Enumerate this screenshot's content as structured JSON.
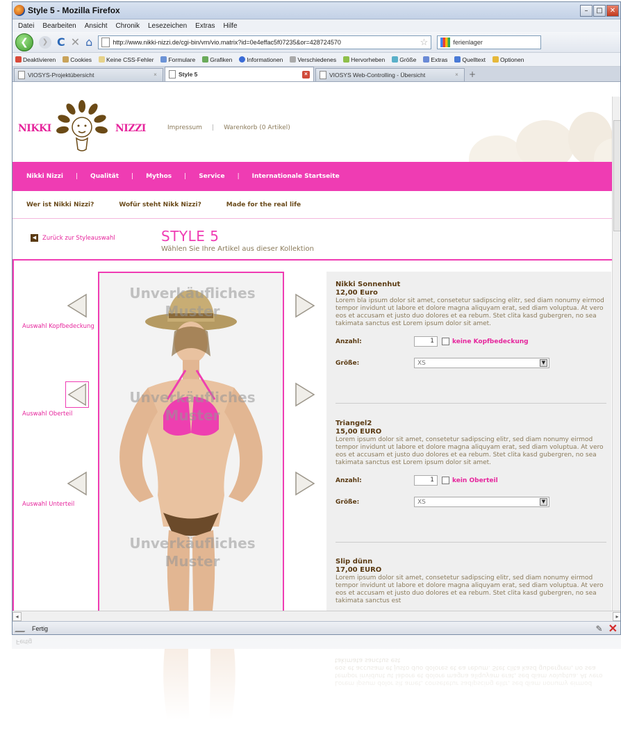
{
  "browser": {
    "window_title": "Style 5 - Mozilla Firefox",
    "menu": [
      "Datei",
      "Bearbeiten",
      "Ansicht",
      "Chronik",
      "Lesezeichen",
      "Extras",
      "Hilfe"
    ],
    "url": "http://www.nikki-nizzi.de/cgi-bin/vm/vio.matrix?id=0e4effac5f07235&or=428724570",
    "search_value": "ferienlager",
    "devbar": [
      "Deaktivieren",
      "Cookies",
      "Keine CSS-Fehler",
      "Formulare",
      "Grafiken",
      "Informationen",
      "Verschiedenes",
      "Hervorheben",
      "Größe",
      "Extras",
      "Quelltext",
      "Optionen"
    ],
    "tabs": [
      {
        "label": "VIOSYS-Projektübersicht",
        "active": false
      },
      {
        "label": "Style 5",
        "active": true
      },
      {
        "label": "VIOSYS Web-Controlling - Übersicht",
        "active": false
      }
    ],
    "new_tab": "+",
    "status_text": "Fertig"
  },
  "site": {
    "logo_left": "NIKKI",
    "logo_right": "NIZZI",
    "header_links": [
      "Impressum",
      "Warenkorb (0 Artikel)"
    ],
    "main_nav": [
      "Nikki Nizzi",
      "Qualität",
      "Mythos",
      "Service",
      "Internationale Startseite"
    ],
    "sub_nav": [
      "Wer ist Nikki Nizzi?",
      "Wofür steht Nikk Nizzi?",
      "Made for the real life"
    ],
    "back_link": "Zurück zur Styleauswahl",
    "style_title": "STYLE 5",
    "style_subtitle": "Wählen Sie Ihre Artikel aus dieser Kollektion"
  },
  "configurator": {
    "labels": {
      "head": "Auswahl Kopfbedeckung",
      "top": "Auswahl Oberteil",
      "bottom": "Auswahl Unterteil"
    },
    "watermark_line1": "Unverkäufliches",
    "watermark_line2": "Muster",
    "qty_label": "Anzahl:",
    "size_label": "Größe:",
    "products": [
      {
        "name": "Nikki Sonnenhut",
        "price": "12,00 Euro",
        "description": "Lorem bla ipsum dolor sit amet, consetetur sadipscing elitr, sed diam nonumy eirmod tempor invidunt ut labore et dolore magna aliquyam erat, sed diam voluptua. At vero eos et accusam et justo duo dolores et ea rebum. Stet clita kasd gubergren, no sea takimata sanctus est Lorem ipsum dolor sit amet.",
        "quantity": "1",
        "none_label": "keine Kopfbedeckung",
        "size": "XS"
      },
      {
        "name": "Triangel2",
        "price": "15,00 EURO",
        "description": "Lorem ipsum dolor sit amet, consetetur sadipscing elitr, sed diam nonumy eirmod tempor invidunt ut labore et dolore magna aliquyam erat, sed diam voluptua. At vero eos et accusam et justo duo dolores et ea rebum. Stet clita kasd gubergren, no sea takimata sanctus est Lorem ipsum dolor sit amet.",
        "quantity": "1",
        "none_label": "kein Oberteil",
        "size": "XS"
      },
      {
        "name": "Slip dünn",
        "price": "17,00 EURO",
        "description": "Lorem ipsum dolor sit amet, consetetur sadipscing elitr, sed diam nonumy eirmod tempor invidunt ut labore et dolore magna aliquyam erat, sed diam voluptua. At vero eos et accusam et justo duo dolores et ea rebum. Stet clita kasd gubergren, no sea takimata sanctus est",
        "quantity": "",
        "none_label": "",
        "size": ""
      }
    ]
  },
  "colors": {
    "brand_pink": "#ef3cb3",
    "brand_brown": "#5a3a12",
    "text_tan": "#8a7a5a"
  },
  "icons": [
    "firefox-icon",
    "back-arrow-icon",
    "forward-arrow-icon",
    "reload-icon",
    "stop-icon",
    "home-icon",
    "bookmark-star-icon",
    "google-icon",
    "left-arrow-icon",
    "right-arrow-icon",
    "close-icon"
  ]
}
